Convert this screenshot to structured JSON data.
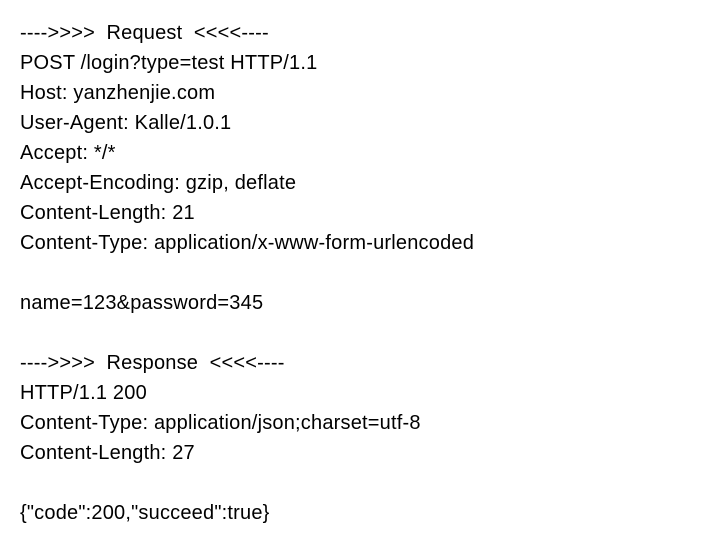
{
  "request": {
    "header": "---->>>>  Request  <<<<----",
    "method_line": "POST /login?type=test HTTP/1.1",
    "headers": {
      "host": "Host: yanzhenjie.com",
      "user_agent": "User-Agent: Kalle/1.0.1",
      "accept": "Accept: */*",
      "accept_encoding": "Accept-Encoding: gzip, deflate",
      "content_length": "Content-Length: 21",
      "content_type": "Content-Type: application/x-www-form-urlencoded"
    },
    "body": "name=123&password=345"
  },
  "response": {
    "header": "---->>>>  Response  <<<<----",
    "status_line": "HTTP/1.1 200",
    "headers": {
      "content_type": "Content-Type: application/json;charset=utf-8",
      "content_length": "Content-Length: 27"
    },
    "body": "{\"code\":200,\"succeed\":true}"
  }
}
